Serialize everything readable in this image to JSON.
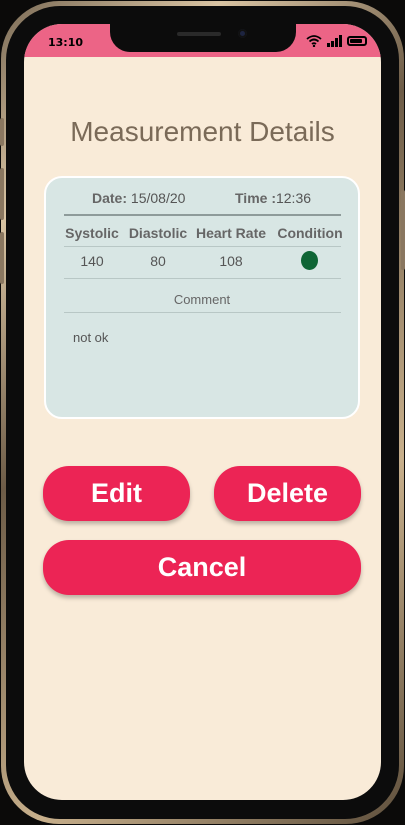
{
  "status_bar": {
    "time": "13:10"
  },
  "page": {
    "title": "Measurement Details"
  },
  "details": {
    "date_label": "Date:",
    "date_value": "15/08/20",
    "time_label": "Time :",
    "time_value": "12:36",
    "columns": [
      "Systolic",
      "Diastolic",
      "Heart Rate",
      "Condition"
    ],
    "systolic": "140",
    "diastolic": "80",
    "heart_rate": "108",
    "condition_color": "#0f6535",
    "comment_label": "Comment",
    "comment": "not ok"
  },
  "buttons": {
    "edit": "Edit",
    "delete": "Delete",
    "cancel": "Cancel"
  },
  "colors": {
    "status_bar": "#ec6486",
    "accent": "#ec2455",
    "background": "#f9ebd8",
    "card": "#d8e6e4"
  }
}
